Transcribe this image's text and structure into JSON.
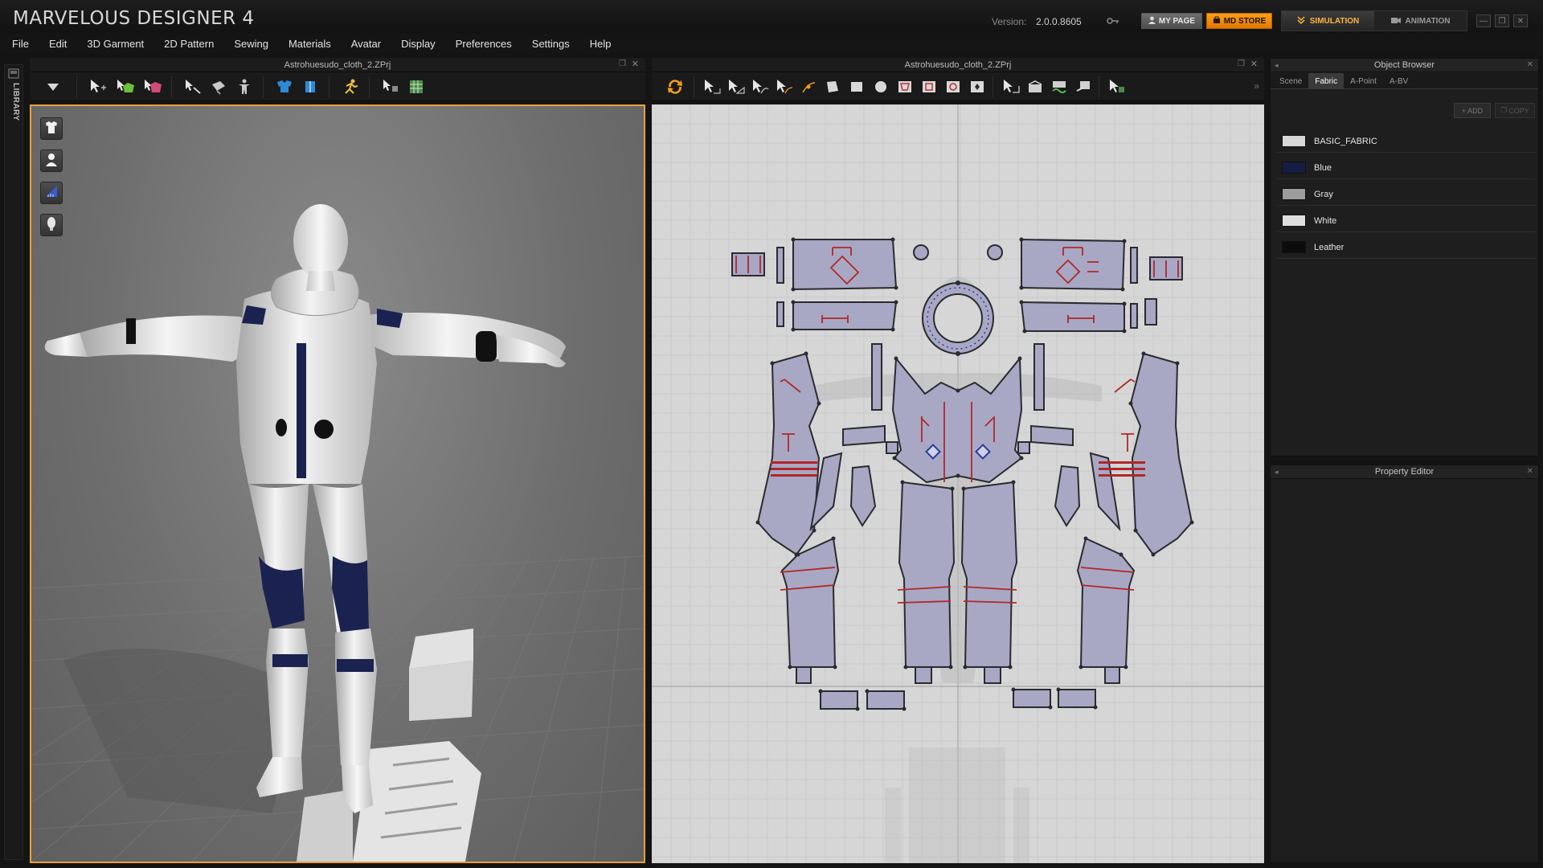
{
  "app": {
    "title": "MARVELOUS DESIGNER 4",
    "version_label": "Version:",
    "version_value": "2.0.0.8605",
    "my_page": "MY PAGE",
    "md_store": "MD STORE",
    "mode_simulation": "SIMULATION",
    "mode_animation": "ANIMATION"
  },
  "menu": [
    "File",
    "Edit",
    "3D Garment",
    "2D Pattern",
    "Sewing",
    "Materials",
    "Avatar",
    "Display",
    "Preferences",
    "Settings",
    "Help"
  ],
  "library": {
    "label": "LIBRARY"
  },
  "panel3d": {
    "title": "Astrohuesudo_cloth_2.ZPrj"
  },
  "panel2d": {
    "title": "Astrohuesudo_cloth_2.ZPrj"
  },
  "object_browser": {
    "title": "Object Browser",
    "tabs": [
      "Scene",
      "Fabric",
      "A-Point",
      "A-BV"
    ],
    "active_tab": "Fabric",
    "add_label": "ADD",
    "copy_label": "COPY",
    "fabrics": [
      {
        "name": "BASIC_FABRIC",
        "color": "#d8d8d8"
      },
      {
        "name": "Blue",
        "color": "#151d44"
      },
      {
        "name": "Gray",
        "color": "#9c9c9c"
      },
      {
        "name": "White",
        "color": "#dedede"
      },
      {
        "name": "Leather",
        "color": "#0c0c0c"
      }
    ]
  },
  "property_editor": {
    "title": "Property Editor"
  },
  "colors": {
    "accent": "#f39c1c",
    "viewport_border": "#e8a13a",
    "pattern_fill": "#aaaac0",
    "sewing_red": "#b02828",
    "pattern_outline": "#2a2a30"
  }
}
